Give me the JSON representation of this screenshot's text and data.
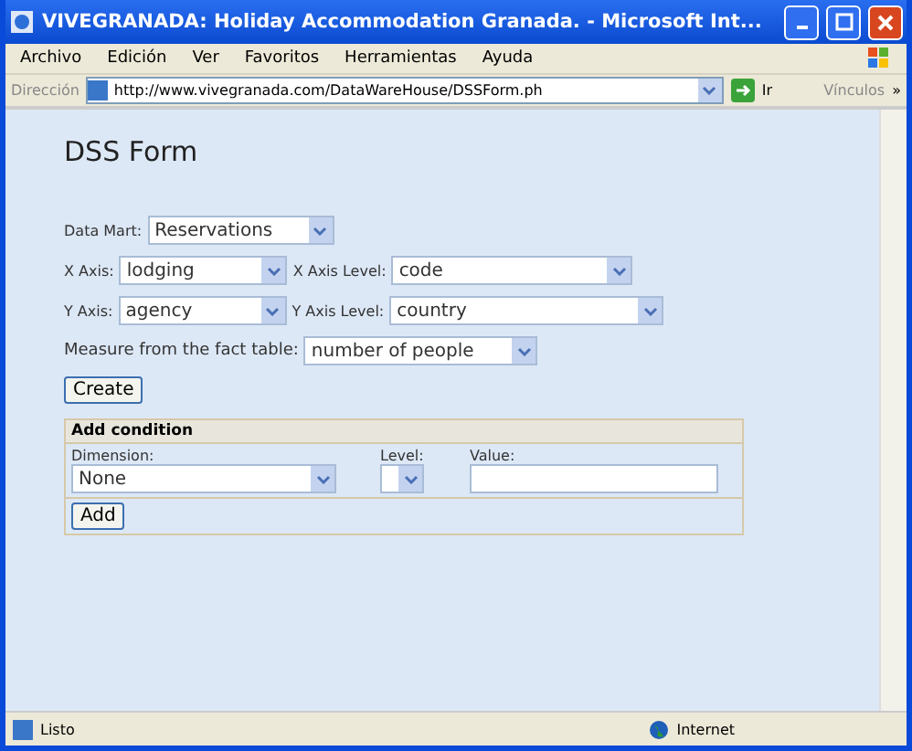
{
  "window": {
    "title": "VIVEGRANADA: Holiday Accommodation Granada. - Microsoft Int..."
  },
  "menu": [
    "Archivo",
    "Edición",
    "Ver",
    "Favoritos",
    "Herramientas",
    "Ayuda"
  ],
  "address_bar": {
    "label": "Dirección",
    "url": "http://www.vivegranada.com/DataWareHouse/DSSForm.ph",
    "go": "Ir",
    "links": "Vínculos",
    "more": "»"
  },
  "form": {
    "title": "DSS Form",
    "data_mart": {
      "label": "Data Mart:",
      "value": "Reservations"
    },
    "x_axis": {
      "label": "X Axis:",
      "value": "lodging"
    },
    "x_axis_level": {
      "label": "X Axis Level:",
      "value": "code"
    },
    "y_axis": {
      "label": "Y Axis:",
      "value": "agency"
    },
    "y_axis_level": {
      "label": "Y Axis Level:",
      "value": "country"
    },
    "measure": {
      "label": "Measure from the fact table:",
      "value": "number of people"
    },
    "create_button": "Create",
    "condition": {
      "title": "Add condition",
      "dimension_label": "Dimension:",
      "dimension_value": "None",
      "level_label": "Level:",
      "value_label": "Value:",
      "add_button": "Add"
    }
  },
  "status_bar": {
    "text": "Listo",
    "zone": "Internet"
  }
}
